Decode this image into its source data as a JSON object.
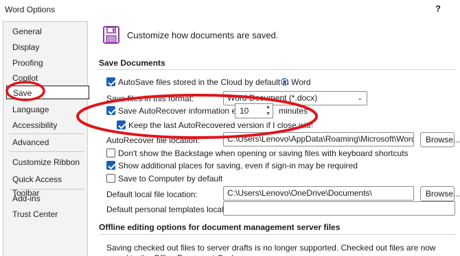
{
  "window": {
    "title": "Word Options",
    "help": "?"
  },
  "sidebar": {
    "items": [
      {
        "label": "General"
      },
      {
        "label": "Display"
      },
      {
        "label": "Proofing"
      },
      {
        "label": "Copilot"
      },
      {
        "label": "Save",
        "selected": true
      },
      {
        "label": "Language"
      },
      {
        "label": "Accessibility"
      },
      {
        "label": "Advanced"
      },
      {
        "label": "Customize Ribbon"
      },
      {
        "label": "Quick Access Toolbar"
      },
      {
        "label": "Add-ins"
      },
      {
        "label": "Trust Center"
      }
    ]
  },
  "main": {
    "header": "Customize how documents are saved.",
    "save_section": {
      "title": "Save Documents",
      "autosave_label": "AutoSave files stored in the Cloud by default in Word",
      "autosave_checked": true,
      "format_label": "Save files in this format:",
      "format_value": "Word Document (*.docx)",
      "autorecover_label": "Save AutoRecover information every",
      "autorecover_checked": true,
      "autorecover_minutes": "10",
      "minutes_label": "minutes",
      "keep_last_label": "Keep the last AutoRecovered version if I close without saving",
      "keep_last_checked": true,
      "autorecover_location_label": "AutoRecover file location:",
      "autorecover_location_value": "C:\\Users\\Lenovo\\AppData\\Roaming\\Microsoft\\Word\\",
      "browse_label": "Browse...",
      "backstage_label": "Don't show the Backstage when opening or saving files with keyboard shortcuts",
      "backstage_checked": false,
      "additional_places_label": "Show additional places for saving, even if sign-in may be required",
      "additional_places_checked": true,
      "save_to_computer_label": "Save to Computer by default",
      "save_to_computer_checked": false,
      "default_local_label": "Default local file location:",
      "default_local_value": "C:\\Users\\Lenovo\\OneDrive\\Documents\\",
      "default_personal_label": "Default personal templates location:",
      "default_personal_value": ""
    },
    "offline_section": {
      "title": "Offline editing options for document management server files",
      "body": "Saving checked out files to server drafts is no longer supported. Checked out files are now saved to the Office Document Cache."
    }
  },
  "colors": {
    "checkbox_accent": "#1a5fb4",
    "annotation_red": "#e0141b"
  },
  "icons": {
    "save": "floppy-disk-icon",
    "info": "info-icon",
    "dropdown": "chevron-down-icon"
  }
}
